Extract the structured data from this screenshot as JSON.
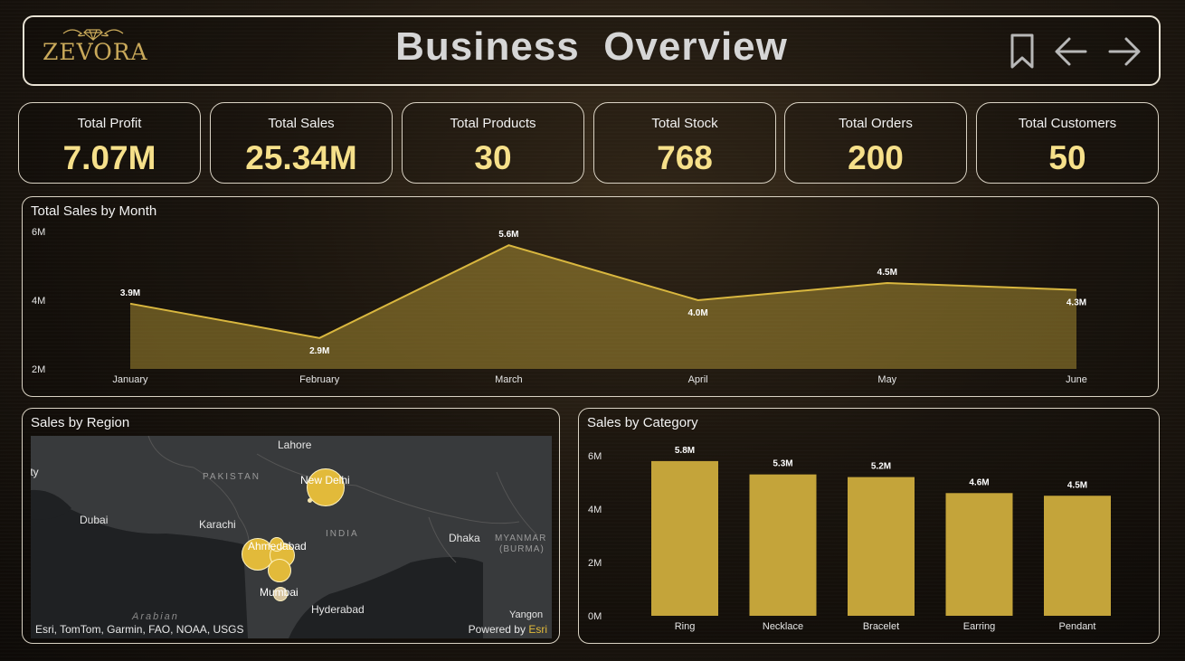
{
  "header": {
    "brand": "ZEVORA",
    "title": "Business  Overview",
    "icons": [
      "bookmark-icon",
      "arrow-left-icon",
      "arrow-right-icon"
    ]
  },
  "kpis": [
    {
      "label": "Total Profit",
      "value": "7.07M"
    },
    {
      "label": "Total Sales",
      "value": "25.34M"
    },
    {
      "label": "Total Products",
      "value": "30"
    },
    {
      "label": "Total Stock",
      "value": "768"
    },
    {
      "label": "Total Orders",
      "value": "200"
    },
    {
      "label": "Total Customers",
      "value": "50"
    }
  ],
  "colors": {
    "accent": "#c4a43a",
    "kpi_value": "#f6e08a",
    "border": "#d9d2c3"
  },
  "map": {
    "title": "Sales by Region",
    "labels": [
      "Lahore",
      "PAKISTAN",
      "New Delhi",
      "Dubai",
      "Karachi",
      "INDIA",
      "Ahmedabad",
      "Dhaka",
      "MYANMAR",
      "(BURMA)",
      "Mumbai",
      "Hyderabad",
      "Arabian",
      "Yangon",
      "City"
    ],
    "attribution": "Esri, TomTom, Garmin, FAO, NOAA, USGS",
    "powered_by": "Powered by",
    "powered_brand": "Esri"
  },
  "chart_data": [
    {
      "type": "area",
      "title": "Total Sales by Month",
      "categories": [
        "January",
        "February",
        "March",
        "April",
        "May",
        "June"
      ],
      "values": [
        3.9,
        2.9,
        5.6,
        4.0,
        4.5,
        4.3
      ],
      "data_labels": [
        "3.9M",
        "2.9M",
        "5.6M",
        "4.0M",
        "4.5M",
        "4.3M"
      ],
      "yticks": [
        "2M",
        "4M",
        "6M"
      ],
      "ylim": [
        2,
        6
      ],
      "grid": false
    },
    {
      "type": "bar",
      "title": "Sales by Category",
      "categories": [
        "Ring",
        "Necklace",
        "Bracelet",
        "Earring",
        "Pendant"
      ],
      "values": [
        5.8,
        5.3,
        5.2,
        4.6,
        4.5
      ],
      "data_labels": [
        "5.8M",
        "5.3M",
        "5.2M",
        "4.6M",
        "4.5M"
      ],
      "yticks": [
        "0M",
        "2M",
        "4M",
        "6M"
      ],
      "ylim": [
        0,
        6
      ],
      "grid": false
    }
  ]
}
